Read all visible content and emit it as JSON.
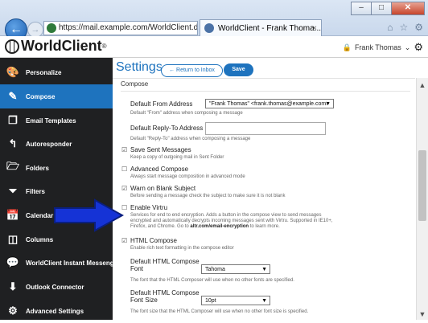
{
  "browser": {
    "url": "https://mail.example.com/WorldClient.dl",
    "url_controls": "⌕ ▾ 🔒 ↻",
    "tab_title": "WorldClient - Frank Thoma...",
    "tab_close": "×",
    "window_buttons": [
      "–",
      "□",
      "✕"
    ],
    "toolbar_icons": [
      "⌂",
      "☆",
      "⚙"
    ]
  },
  "header": {
    "logo_text": "WorldClient",
    "logo_mark": "®",
    "user_name": "Frank Thomas",
    "user_caret": "⌄"
  },
  "sidebar": {
    "items": [
      {
        "label": "Personalize",
        "icon": "palette-icon",
        "glyph": "🎨"
      },
      {
        "label": "Compose",
        "icon": "compose-icon",
        "glyph": "✎"
      },
      {
        "label": "Email Templates",
        "icon": "templates-icon",
        "glyph": "❐"
      },
      {
        "label": "Autoresponder",
        "icon": "reply-icon",
        "glyph": "↰"
      },
      {
        "label": "Folders",
        "icon": "folder-icon",
        "glyph": "🗁"
      },
      {
        "label": "Filters",
        "icon": "filter-icon",
        "glyph": "⏷"
      },
      {
        "label": "Calendar",
        "icon": "calendar-icon",
        "glyph": "📅"
      },
      {
        "label": "Columns",
        "icon": "columns-icon",
        "glyph": "◫"
      },
      {
        "label": "WorldClient Instant Messenger",
        "icon": "messenger-icon",
        "glyph": "💬"
      },
      {
        "label": "Outlook Connector",
        "icon": "download-icon",
        "glyph": "⬇"
      },
      {
        "label": "Advanced Settings",
        "icon": "gears-icon",
        "glyph": "⚙"
      }
    ],
    "active": "Compose"
  },
  "main": {
    "title": "Settings",
    "return_label": "← Return to Inbox",
    "save_label": "Save",
    "section": "Compose",
    "default_from": {
      "label": "Default From Address",
      "value": "\"Frank Thomas\" <frank.thomas@example.com>",
      "desc": "Default \"From\" address when composing a message"
    },
    "default_replyto": {
      "label": "Default Reply-To Address",
      "value": "",
      "desc": "Default \"Reply-To\" address when composing a message"
    },
    "save_sent": {
      "label": "Save Sent Messages",
      "checked": true,
      "desc": "Keep a copy of outgoing mail in Sent Folder"
    },
    "advanced_compose": {
      "label": "Advanced Compose",
      "checked": false,
      "desc": "Always start message composition in advanced mode"
    },
    "warn_blank": {
      "label": "Warn on Blank Subject",
      "checked": true,
      "desc": "Before sending a message check the subject to make sure it is not blank"
    },
    "enable_virtru": {
      "label": "Enable Virtru",
      "checked": false,
      "desc_line1": "Services for end to end encryption. Adds a button in the compose view to send messages",
      "desc_line2": "encrypted and automatically decrypts incoming messages sent with Virtru. Supported in IE10+,",
      "desc_line3_pre": "Firefox, and Chrome. Go to ",
      "desc_link": "altr.com/email-encryption",
      "desc_line3_post": " to learn more."
    },
    "html_compose": {
      "label": "HTML Compose",
      "checked": true,
      "desc": "Enable rich text formatting in the compose editor"
    },
    "html_font": {
      "label_line1": "Default HTML Compose",
      "label_line2": "Font",
      "value": "Tahoma",
      "desc": "The font that the HTML Composer will use when no other fonts are specified."
    },
    "html_font_size": {
      "label_line1": "Default HTML Compose",
      "label_line2": "Font Size",
      "value": "10pt",
      "desc": "The font size that the HTML Composer will use when no other font size is specified."
    },
    "check_on": "☑",
    "check_off": "☐",
    "caret": "▼"
  },
  "colors": {
    "accent": "#1e73be",
    "sidebar_bg": "#1f2022",
    "arrow": "#1533d6"
  }
}
